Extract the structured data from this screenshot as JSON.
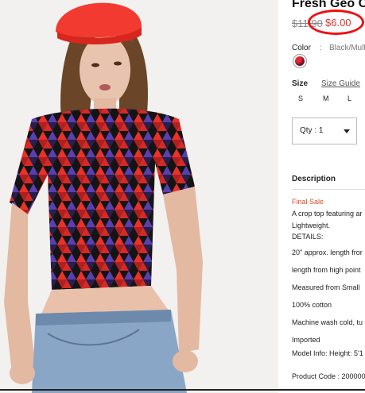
{
  "product": {
    "title": "Fresh Geo Cr",
    "original_price": "$11.90",
    "sale_price": "$6.00"
  },
  "options": {
    "color_label": "Color",
    "color_separator": ":",
    "color_value": "Black/Multi",
    "size_label": "Size",
    "size_guide": "Size Guide",
    "sizes": [
      "S",
      "M",
      "L"
    ],
    "quantity": "Qty : 1"
  },
  "description": {
    "heading": "Description",
    "lines": [
      "Final Sale",
      "A crop top featuring ar",
      "Lightweight.",
      "DETAILS:",
      "20\" approx. length fror",
      "length from high point",
      "Measured from Small",
      "100% cotton",
      "Machine wash cold, tu",
      "Imported",
      "Model Info: Height: 5'1",
      "Product Code : 200000"
    ]
  },
  "colors": {
    "sale_red": "#d33333",
    "circle_annotation": "#ee1111",
    "final_sale_orange": "#d0502a"
  },
  "icons": {
    "swatch": "color-swatch-icon",
    "quantity_dropdown": "caret-down-icon"
  }
}
